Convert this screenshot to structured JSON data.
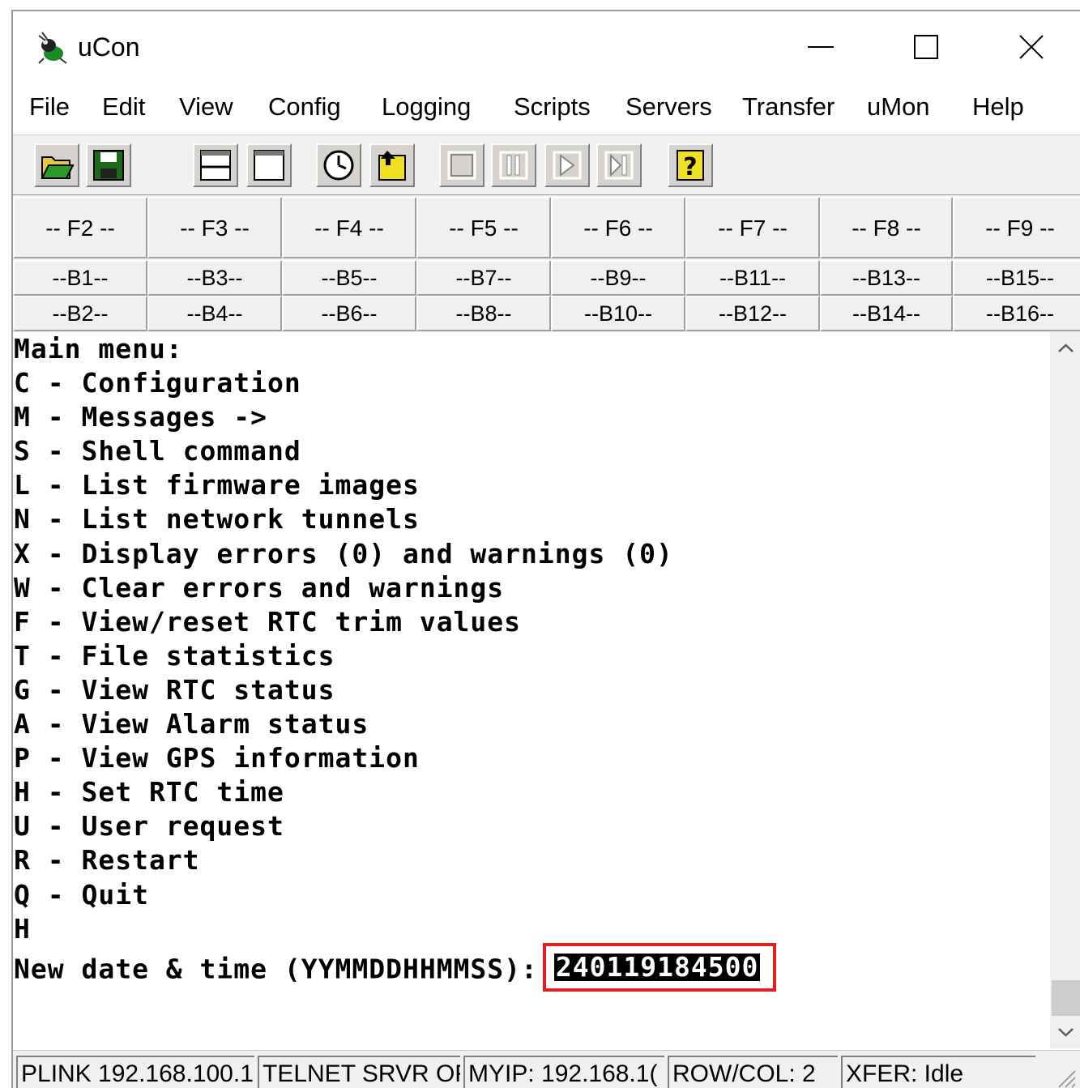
{
  "window": {
    "title": "uCon"
  },
  "menu": [
    "File",
    "Edit",
    "View",
    "Config",
    "Logging",
    "Scripts",
    "Servers",
    "Transfer",
    "uMon",
    "Help"
  ],
  "toolbar": {
    "buttons": [
      "open-folder-icon",
      "save-disk-icon",
      "split-horizontal-icon",
      "single-pane-icon",
      "clock-icon",
      "load-script-icon",
      "stop-icon",
      "pause-icon",
      "play-icon",
      "step-icon",
      "help-icon"
    ]
  },
  "function_keys": [
    "-- F2 --",
    "-- F3 --",
    "-- F4 --",
    "-- F5 --",
    "-- F6 --",
    "-- F7 --",
    "-- F8 --",
    "-- F9 --"
  ],
  "buttons_row1": [
    "--B1--",
    "--B3--",
    "--B5--",
    "--B7--",
    "--B9--",
    "--B11--",
    "--B13--",
    "--B15--"
  ],
  "buttons_row2": [
    "--B2--",
    "--B4--",
    "--B6--",
    "--B8--",
    "--B10--",
    "--B12--",
    "--B14--",
    "--B16--"
  ],
  "terminal": {
    "lines": [
      "Main menu:",
      "C - Configuration",
      "M - Messages ->",
      "S - Shell command",
      "L - List firmware images",
      "N - List network tunnels",
      "X - Display errors (0) and warnings (0)",
      "W - Clear errors and warnings",
      "F - View/reset RTC trim values",
      "T - File statistics",
      "G - View RTC status",
      "A - View Alarm status",
      "P - View GPS information",
      "H - Set RTC time",
      "U - User request",
      "R - Restart",
      "Q - Quit",
      "H"
    ],
    "prompt_label": "New date & time (YYMMDDHHMMSS):",
    "input_value": "240119184500"
  },
  "status": [
    "PLINK 192.168.100.1",
    "TELNET SRVR OF",
    "MYIP: 192.168.1(",
    "ROW/COL: 2",
    "XFER: Idle"
  ],
  "colors": {
    "highlight": "#e02020",
    "chrome": "#f0f0f0"
  }
}
